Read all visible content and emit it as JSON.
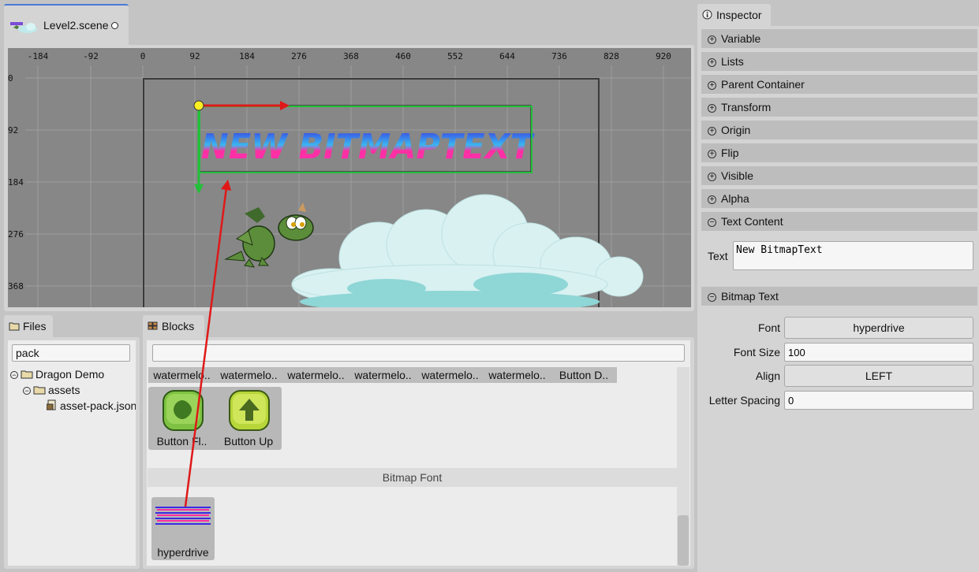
{
  "editor": {
    "tab_label": "Level2.scene"
  },
  "scene": {
    "ruler_x": [
      "-184",
      "-92",
      "0",
      "92",
      "184",
      "276",
      "368",
      "460",
      "552",
      "644",
      "736",
      "828",
      "920"
    ],
    "ruler_y": [
      "0",
      "92",
      "184",
      "276",
      "368"
    ],
    "bitmap_text": "NEW BITMAPTEXT"
  },
  "files": {
    "tab_label": "Files",
    "search_value": "pack",
    "tree": [
      {
        "label": "Dragon Demo"
      },
      {
        "label": "assets"
      },
      {
        "label": "asset-pack.json"
      }
    ]
  },
  "blocks": {
    "tab_label": "Blocks",
    "search_value": "",
    "categories": [
      "watermelo..",
      "watermelo..",
      "watermelo..",
      "watermelo..",
      "watermelo..",
      "watermelo..",
      "Button D.."
    ],
    "buttons": [
      {
        "label": "Button Fl..",
        "icon": "button-flower-icon"
      },
      {
        "label": "Button Up",
        "icon": "button-up-arrow-icon"
      }
    ],
    "font_section_label": "Bitmap Font",
    "font_item": {
      "label": "hyperdrive"
    }
  },
  "inspector": {
    "tab_label": "Inspector",
    "sections": [
      {
        "label": "Variable",
        "toggle": "⊕"
      },
      {
        "label": "Lists",
        "toggle": "⊕"
      },
      {
        "label": "Parent Container",
        "toggle": "⊕"
      },
      {
        "label": "Transform",
        "toggle": "⊕"
      },
      {
        "label": "Origin",
        "toggle": "⊕"
      },
      {
        "label": "Flip",
        "toggle": "⊕"
      },
      {
        "label": "Visible",
        "toggle": "⊕"
      },
      {
        "label": "Alpha",
        "toggle": "⊕"
      },
      {
        "label": "Text Content",
        "toggle": "⊖"
      }
    ],
    "text_content": {
      "label": "Text",
      "value": "New BitmapText"
    },
    "bitmap_text": {
      "header": "Bitmap Text",
      "toggle": "⊖",
      "font_label": "Font",
      "font_value": "hyperdrive",
      "font_size_label": "Font Size",
      "font_size_value": "100",
      "align_label": "Align",
      "align_value": "LEFT",
      "letter_spacing_label": "Letter Spacing",
      "letter_spacing_value": "0"
    }
  },
  "colors": {
    "accent": "#4a78d8",
    "selection": "#22c03a",
    "arrow_x": "#e01818",
    "handle": "#ffee22"
  }
}
